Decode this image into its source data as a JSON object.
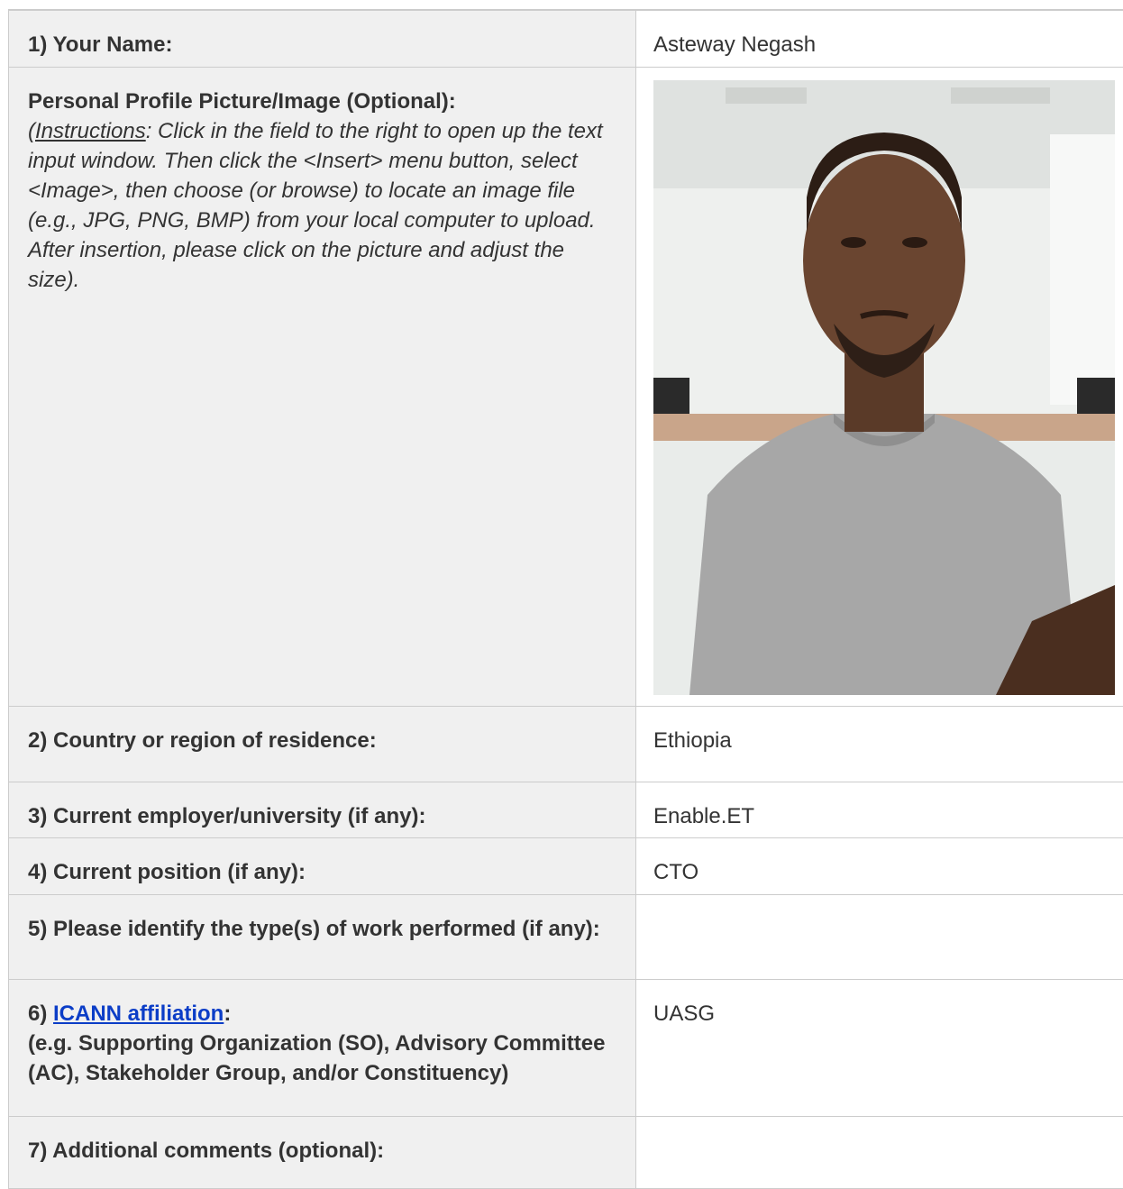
{
  "form": {
    "rows": [
      {
        "label": "1) Your Name:",
        "value": "Asteway Negash"
      },
      {
        "label": "Personal Profile Picture/Image (Optional):"
      },
      {
        "label": "2) Country or region of residence:",
        "value": "Ethiopia"
      },
      {
        "label": "3) Current employer/university (if any):",
        "value": "Enable.ET"
      },
      {
        "label": "4) Current position (if any):",
        "value": "CTO"
      },
      {
        "label": "5) Please identify the type(s) of work performed (if any):",
        "value": ""
      },
      {
        "label_prefix": "6) ",
        "link": "ICANN affiliation",
        "label_colon": ":",
        "sub": "(e.g. Supporting Organization (SO), Advisory Committee (AC), Stakeholder Group, and/or Constituency)",
        "value": "UASG"
      },
      {
        "label": "7) Additional comments (optional):",
        "value": ""
      }
    ],
    "instructions": {
      "open": "(",
      "keyword": "Instructions",
      "text": ": Click in the field to the right to open up the text input window. Then click the <Insert> menu button, select <Image>, then choose (or browse) to locate an image file (e.g., JPG, PNG, BMP) from your local computer to upload. After insertion, please click on the picture and adjust the size)."
    }
  },
  "colors": {
    "label_bg": "#f0f0f0",
    "border": "#cccccc",
    "link": "#0b3dc7"
  }
}
